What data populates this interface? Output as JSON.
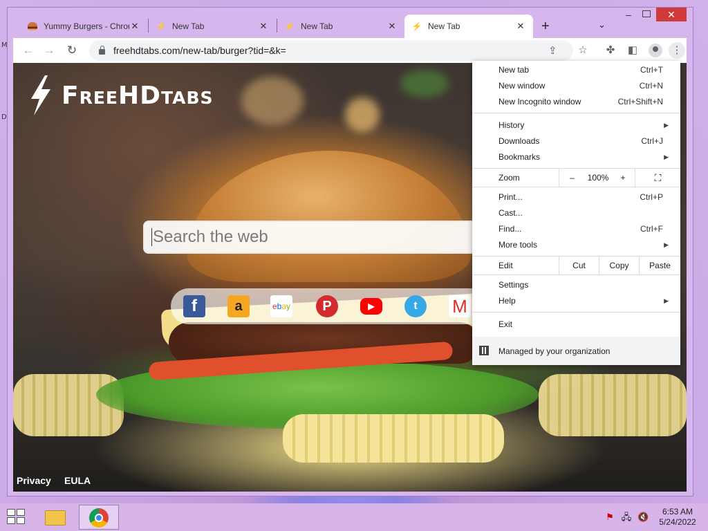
{
  "desktop": {
    "marks": [
      "M",
      "D"
    ]
  },
  "tabs": [
    {
      "title": "Yummy Burgers - Chrome",
      "icon": "burger-favicon"
    },
    {
      "title": "New Tab",
      "icon": "bolt-favicon"
    },
    {
      "title": "New Tab",
      "icon": "bolt-favicon"
    },
    {
      "title": "New Tab",
      "icon": "bolt-favicon",
      "active": true
    }
  ],
  "window_controls": {
    "minimize": "–",
    "close": "✕"
  },
  "toolbar": {
    "url": "freehdtabs.com/new-tab/burger?tid=&k="
  },
  "page": {
    "logo_text": "FreeHDtabs",
    "search_placeholder": "Search the web",
    "shortcuts": [
      {
        "name": "Facebook",
        "glyph": "f"
      },
      {
        "name": "Amazon",
        "glyph": "a"
      },
      {
        "name": "eBay",
        "glyph": "ebay"
      },
      {
        "name": "Pinterest",
        "glyph": "P"
      },
      {
        "name": "YouTube",
        "glyph": "▶"
      },
      {
        "name": "Twitter",
        "glyph": "t"
      },
      {
        "name": "Gmail",
        "glyph": "M"
      }
    ],
    "footer": {
      "privacy": "Privacy",
      "eula": "EULA"
    }
  },
  "menu": {
    "new_tab": {
      "label": "New tab",
      "shortcut": "Ctrl+T"
    },
    "new_window": {
      "label": "New window",
      "shortcut": "Ctrl+N"
    },
    "incognito": {
      "label": "New Incognito window",
      "shortcut": "Ctrl+Shift+N"
    },
    "history": {
      "label": "History"
    },
    "downloads": {
      "label": "Downloads",
      "shortcut": "Ctrl+J"
    },
    "bookmarks": {
      "label": "Bookmarks"
    },
    "zoom": {
      "label": "Zoom",
      "minus": "–",
      "value": "100%",
      "plus": "+"
    },
    "print": {
      "label": "Print...",
      "shortcut": "Ctrl+P"
    },
    "cast": {
      "label": "Cast..."
    },
    "find": {
      "label": "Find...",
      "shortcut": "Ctrl+F"
    },
    "more_tools": {
      "label": "More tools"
    },
    "edit": {
      "label": "Edit",
      "cut": "Cut",
      "copy": "Copy",
      "paste": "Paste"
    },
    "settings": {
      "label": "Settings"
    },
    "help": {
      "label": "Help"
    },
    "exit": {
      "label": "Exit"
    },
    "managed": {
      "label": "Managed by your organization"
    }
  },
  "taskbar": {
    "time": "6:53 AM",
    "date": "5/24/2022"
  },
  "colors": {
    "desktop_bg": "#c9a0dc",
    "window_frame": "#d7b6ee",
    "close_button": "#d13a3a"
  }
}
